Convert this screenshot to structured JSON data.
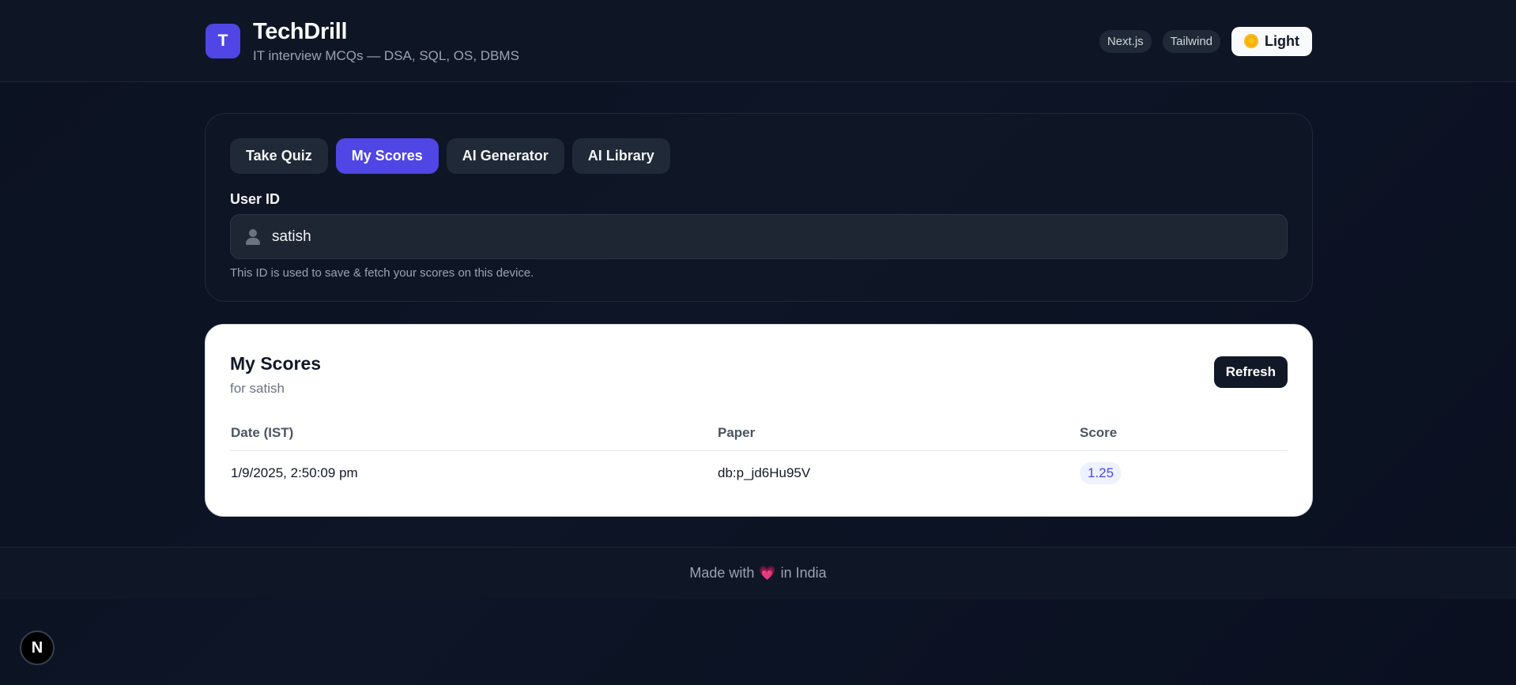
{
  "header": {
    "logo_letter": "T",
    "title": "TechDrill",
    "subtitle": "IT interview MCQs — DSA, SQL, OS, DBMS",
    "pills": [
      "Next.js",
      "Tailwind"
    ],
    "theme_label": "Light",
    "theme_icon": "sun-icon"
  },
  "tabs": [
    {
      "label": "Take Quiz",
      "active": false
    },
    {
      "label": "My Scores",
      "active": true
    },
    {
      "label": "AI Generator",
      "active": false
    },
    {
      "label": "AI Library",
      "active": false
    }
  ],
  "user_field": {
    "label": "User ID",
    "value": "satish",
    "icon": "user-icon",
    "hint": "This ID is used to save & fetch your scores on this device."
  },
  "scores": {
    "title": "My Scores",
    "subtitle": "for satish",
    "refresh_label": "Refresh",
    "columns": [
      "Date (IST)",
      "Paper",
      "Score"
    ],
    "rows": [
      {
        "date": "1/9/2025, 2:50:09 pm",
        "paper": "db:p_jd6Hu95V",
        "score": "1.25"
      }
    ]
  },
  "footer": {
    "prefix": "Made with",
    "heart": "💗",
    "suffix": "in India"
  },
  "dev_badge": {
    "letter": "N"
  },
  "colors": {
    "accent": "#4f46e5",
    "background": "#0b1221",
    "card": "#ffffff"
  }
}
